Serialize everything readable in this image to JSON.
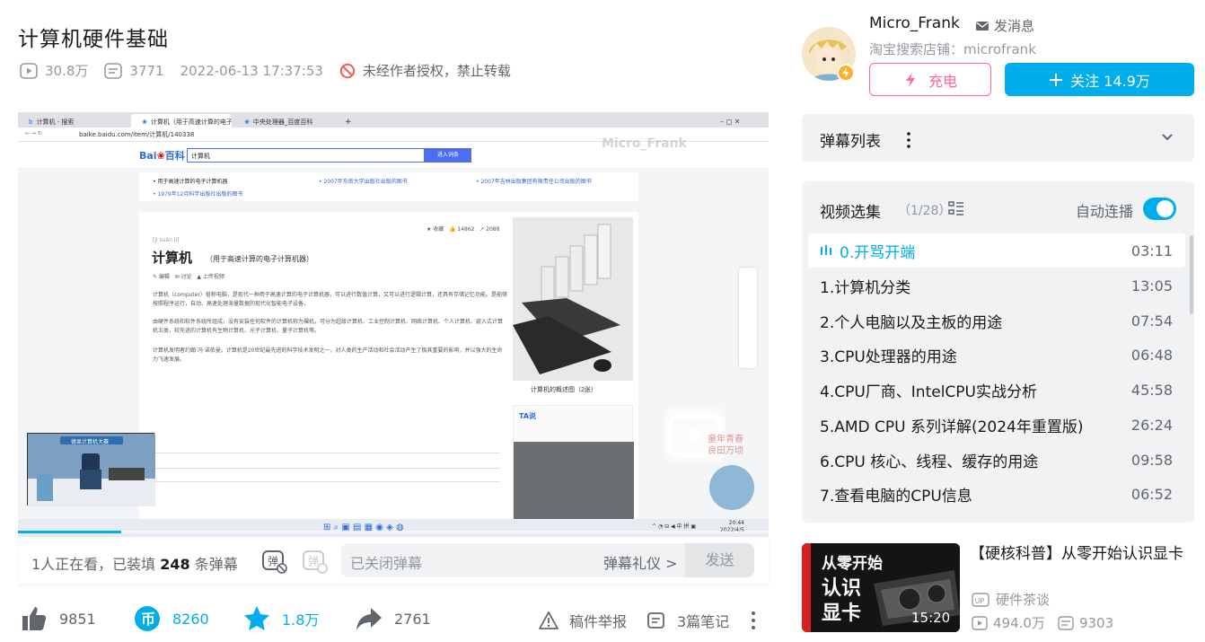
{
  "video": {
    "title": "计算机硬件基础",
    "plays": "30.8万",
    "danmaku_count": "3771",
    "date": "2022-06-13 17:37:53",
    "copyright": "未经作者授权，禁止转载"
  },
  "player": {
    "browser_tabs": [
      "计算机 - 搜索",
      "计算机（用于高速计算的电子计算...",
      "中央处理器_百度百科"
    ],
    "url": "baike.baidu.com/item/计算机/140338",
    "search_value": "计算机",
    "search_button": "进入词条",
    "watermark": "Micro_Frank",
    "article_title": "计算机",
    "article_subtitle": "（用于高速计算的电子计算机器）",
    "pinyin": "[jì suàn jī]",
    "article_p1": "计算机（computer）俗称电脑，是现代一种用于高速计算的电子计算机器，可以进行数值计算，又可以进行逻辑计算，还具有存储记忆功能。是能够按照程序运行，自动、高速处理海量数据的现代化智能电子设备。",
    "article_p2": "由硬件系统和软件系统所组成，没有安装任何软件的计算机称为裸机。可分为超级计算机、工业控制计算机、网络计算机、个人计算机、嵌入式计算机五类，较先进的计算机有生物计算机、光子计算机、量子计算机等。",
    "article_p3": "计算机发明者约翰·冯·诺依曼。计算机是20世纪最先进的科学技术发明之一，对人类的生产活动和社会活动产生了极其重要的影响，并以强大的生命力飞速发展。",
    "image_caption": "计算机的概述图（2张）",
    "clock_time": "20:44",
    "clock_date": "2022/4/5",
    "mini_label": "德显计算机大赛",
    "ad_text": "童年青春 良田万顷"
  },
  "danmaku_bar": {
    "viewers_prefix": "1人正在看，已装填 ",
    "viewers_num": "248",
    "viewers_suffix": " 条弹幕",
    "placeholder": "已关闭弹幕",
    "etiquette": "弹幕礼仪 >",
    "send": "发送"
  },
  "toolbar": {
    "likes": "9851",
    "coins": "8260",
    "favorites": "1.8万",
    "shares": "2761",
    "report": "稿件举报",
    "notes": "3篇笔记"
  },
  "uploader": {
    "name": "Micro_Frank",
    "message": "发消息",
    "description": "淘宝搜索店铺：microfrank",
    "charge": "充电",
    "follow": "关注 14.9万"
  },
  "danmaku_list": {
    "title": "弹幕列表"
  },
  "collection": {
    "title": "视频选集",
    "count": "（1/28）",
    "autoplay": "自动连播",
    "episodes": [
      {
        "title": "0.开骂开端",
        "duration": "03:11"
      },
      {
        "title": "1.计算机分类",
        "duration": "13:05"
      },
      {
        "title": "2.个人电脑以及主板的用途",
        "duration": "07:54"
      },
      {
        "title": "3.CPU处理器的用途",
        "duration": "06:48"
      },
      {
        "title": "4.CPU厂商、IntelCPU实战分析",
        "duration": "45:58"
      },
      {
        "title": "5.AMD CPU 系列详解(2024年重置版)",
        "duration": "26:24"
      },
      {
        "title": "6.CPU 核心、线程、缓存的用途",
        "duration": "09:58"
      },
      {
        "title": "7.查看电脑的CPU信息",
        "duration": "06:52"
      }
    ]
  },
  "recommend": {
    "thumb_line1": "从零开始",
    "thumb_line2": "认识",
    "thumb_line3": "显卡",
    "duration": "15:20",
    "title": "【硬核科普】从零开始认识显卡",
    "up_name": "硬件茶谈",
    "plays": "494.0万",
    "danmaku": "9303"
  },
  "colors": {
    "accent": "#00aeec",
    "pink": "#ff6699",
    "text": "#18191c",
    "muted": "#9499a0"
  }
}
